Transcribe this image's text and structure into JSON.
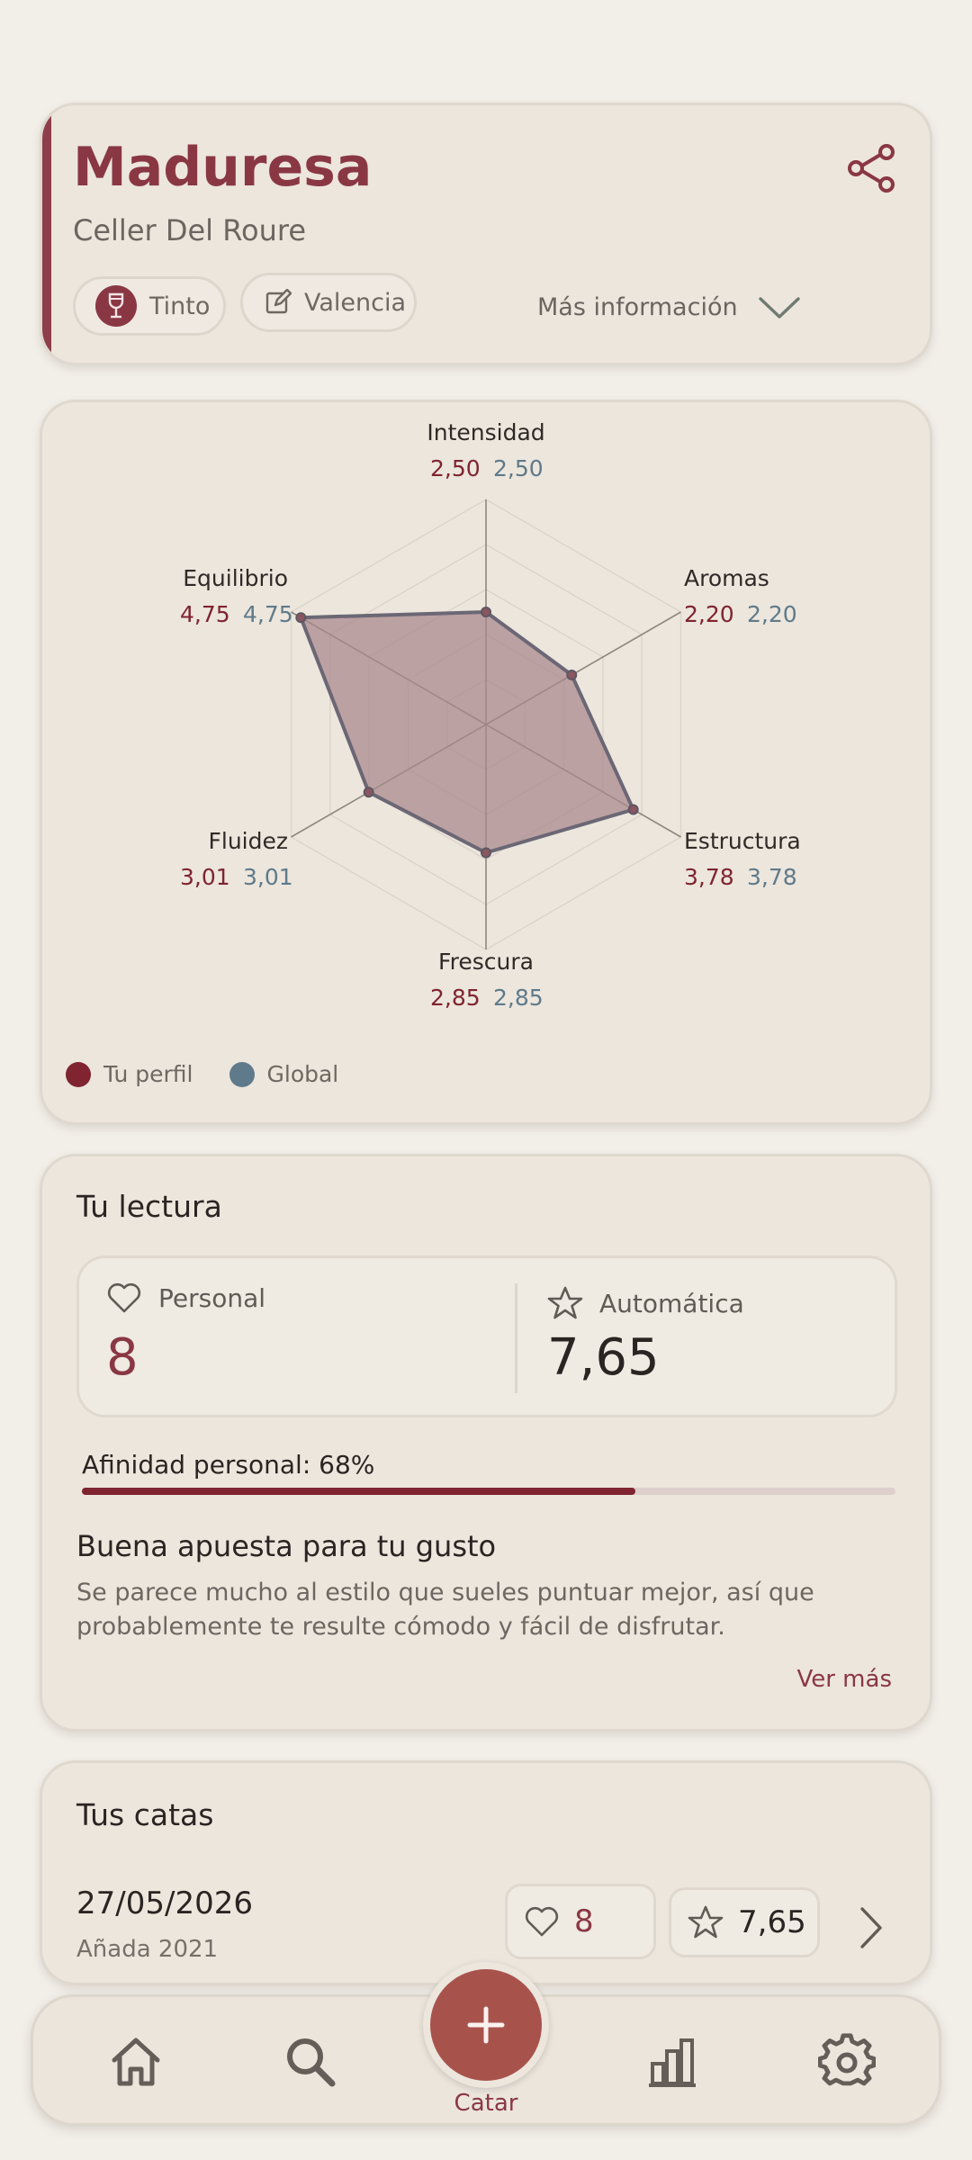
{
  "wine": {
    "name": "Maduresa",
    "winery": "Celler Del Roure",
    "type_chip": "Tinto",
    "region_chip": "Valencia",
    "more_info": "Más información"
  },
  "chart_data": {
    "type": "radar",
    "axes": [
      "Intensidad",
      "Aromas",
      "Estructura",
      "Frescura",
      "Fluidez",
      "Equilibrio"
    ],
    "range": [
      0,
      5
    ],
    "series": [
      {
        "name": "Tu perfil",
        "values": [
          2.5,
          2.2,
          3.78,
          2.85,
          3.01,
          4.75
        ],
        "labels": [
          "2,50",
          "2,20",
          "3,78",
          "2,85",
          "3,01",
          "4,75"
        ]
      },
      {
        "name": "Global",
        "values": [
          2.5,
          2.2,
          3.78,
          2.85,
          3.01,
          4.75
        ],
        "labels": [
          "2,50",
          "2,20",
          "3,78",
          "2,85",
          "3,01",
          "4,75"
        ]
      }
    ],
    "colors": {
      "personal": "#7f2430",
      "global": "#5f7a8a",
      "fill": "#a7878a",
      "stroke": "#6b6775"
    },
    "legend": [
      "Tu perfil",
      "Global"
    ]
  },
  "reading": {
    "title": "Tu lectura",
    "personal_label": "Personal",
    "personal_value": "8",
    "auto_label": "Automática",
    "auto_value": "7,65",
    "affinity_label": "Afinidad personal: 68%",
    "affinity_value": 0.68,
    "advice_title": "Buena apuesta para tu gusto",
    "advice_text": "Se parece mucho al estilo que sueles puntuar mejor, así que probablemente te resulte cómodo y fácil de disfrutar.",
    "see_more": "Ver más"
  },
  "tastings": {
    "title": "Tus catas",
    "items": [
      {
        "date": "27/05/2026",
        "vintage": "Añada 2021",
        "personal": "8",
        "auto": "7,65"
      }
    ]
  },
  "nav": {
    "items": [
      "home-icon",
      "search-icon",
      "add-icon",
      "stats-icon",
      "settings-icon"
    ],
    "fab_label": "Catar"
  },
  "colors": {
    "accent": "#8a3744",
    "fab": "#a7534c",
    "background": "#f2efe9",
    "card": "#ece6dd"
  }
}
